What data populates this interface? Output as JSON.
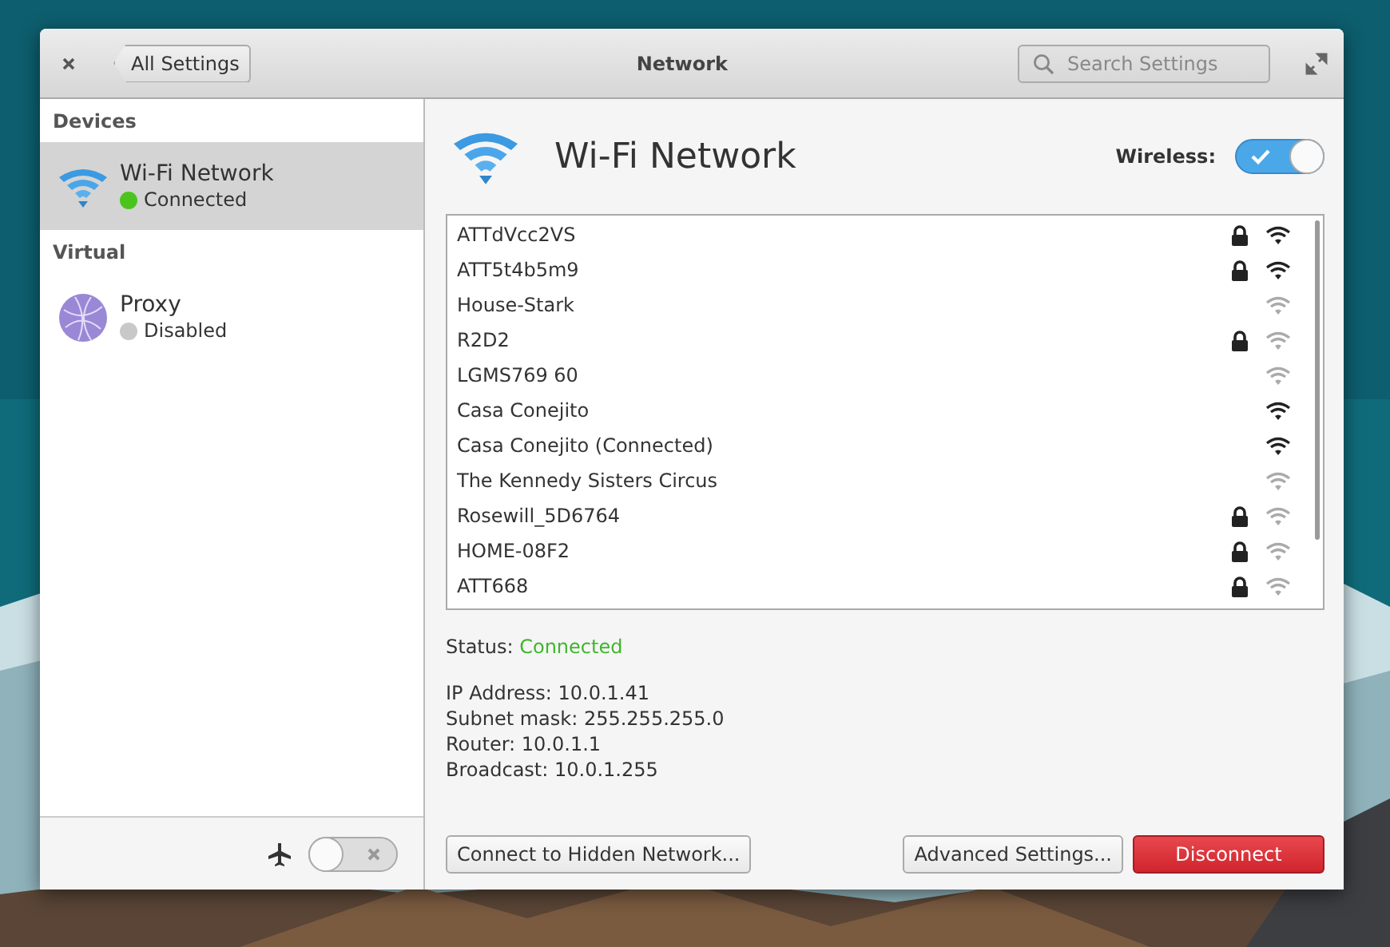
{
  "window": {
    "title": "Network",
    "back_button": "All Settings",
    "search": {
      "placeholder": "Search Settings"
    }
  },
  "sidebar": {
    "sections": [
      {
        "heading": "Devices",
        "items": [
          {
            "kind": "wifi",
            "name": "Wi-Fi Network",
            "status": "Connected",
            "color": "#4cc41e",
            "selected": true
          }
        ]
      },
      {
        "heading": "Virtual",
        "items": [
          {
            "kind": "proxy",
            "name": "Proxy",
            "status": "Disabled",
            "color": "#c8c8c8",
            "selected": false
          }
        ]
      }
    ],
    "airplane_mode": {
      "on": false
    }
  },
  "page": {
    "title": "Wi-Fi Network",
    "wireless": {
      "label": "Wireless:",
      "on": true
    },
    "networks": [
      {
        "name": "ATTdVcc2VS",
        "locked": true,
        "strong": true
      },
      {
        "name": "ATT5t4b5m9",
        "locked": true,
        "strong": true
      },
      {
        "name": "House-Stark",
        "locked": false,
        "strong": false
      },
      {
        "name": "R2D2",
        "locked": true,
        "strong": false
      },
      {
        "name": "LGMS769 60",
        "locked": false,
        "strong": false
      },
      {
        "name": "Casa Conejito",
        "locked": false,
        "strong": true
      },
      {
        "name": "Casa Conejito (Connected)",
        "locked": false,
        "strong": true
      },
      {
        "name": "The Kennedy Sisters Circus",
        "locked": false,
        "strong": false
      },
      {
        "name": "Rosewill_5D6764",
        "locked": true,
        "strong": false
      },
      {
        "name": "HOME-08F2",
        "locked": true,
        "strong": false
      },
      {
        "name": "ATT668",
        "locked": true,
        "strong": false
      }
    ],
    "status": {
      "label": "Status:",
      "value": "Connected"
    },
    "details": [
      "IP Address: 10.0.1.41",
      "Subnet mask: 255.255.255.0",
      "Router: 10.0.1.1",
      "Broadcast: 10.0.1.255"
    ],
    "buttons": [
      {
        "label": "Connect to Hidden Network...",
        "kind": "normal"
      },
      {
        "label": "Advanced Settings...",
        "kind": "normal"
      },
      {
        "label": "Disconnect",
        "kind": "destructive"
      }
    ]
  }
}
